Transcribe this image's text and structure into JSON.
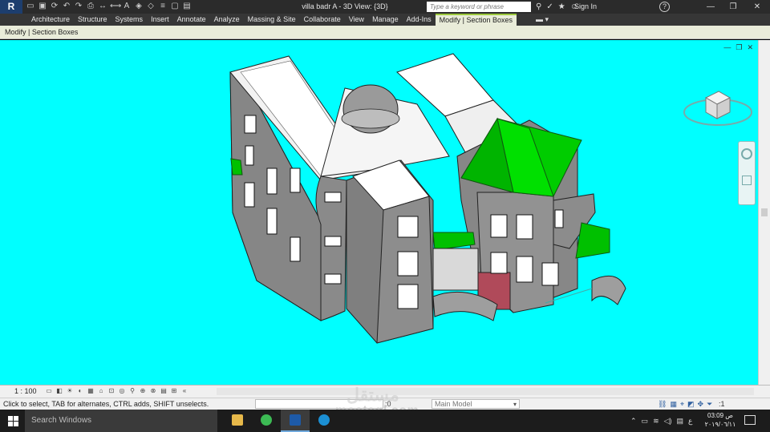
{
  "app": {
    "logo": "R",
    "title": "villa badr A - 3D View: {3D}",
    "search_placeholder": "Type a keyword or phrase",
    "sign_in": "Sign In",
    "help": "?"
  },
  "ribbon": {
    "tabs": [
      {
        "label": "Architecture"
      },
      {
        "label": "Structure"
      },
      {
        "label": "Systems"
      },
      {
        "label": "Insert"
      },
      {
        "label": "Annotate"
      },
      {
        "label": "Analyze"
      },
      {
        "label": "Massing & Site"
      },
      {
        "label": "Collaborate"
      },
      {
        "label": "View"
      },
      {
        "label": "Manage"
      },
      {
        "label": "Add-Ins"
      },
      {
        "label": "Modify | Section Boxes",
        "active": true
      }
    ]
  },
  "context_bar": {
    "label": "Modify | Section Boxes"
  },
  "view_control": {
    "scale": "1 : 100"
  },
  "status": {
    "text": "Click to select, TAB for alternates, CTRL adds, SHIFT unselects.",
    "zero": ":0",
    "model": "Main Model",
    "filter_count": ":1"
  },
  "watermark": {
    "text": "mostaql.com",
    "arabic": "مستقل"
  },
  "taskbar": {
    "search_placeholder": "Search Windows",
    "time": "03:09 ص",
    "date": "٢٠١٩/٠٦/١١",
    "lang": "ع"
  },
  "colors": {
    "viewport": "#00ffff",
    "wall": "#8a8a8a",
    "roof_green": "#00cc00",
    "ribbon_active": "#9cc83c"
  }
}
